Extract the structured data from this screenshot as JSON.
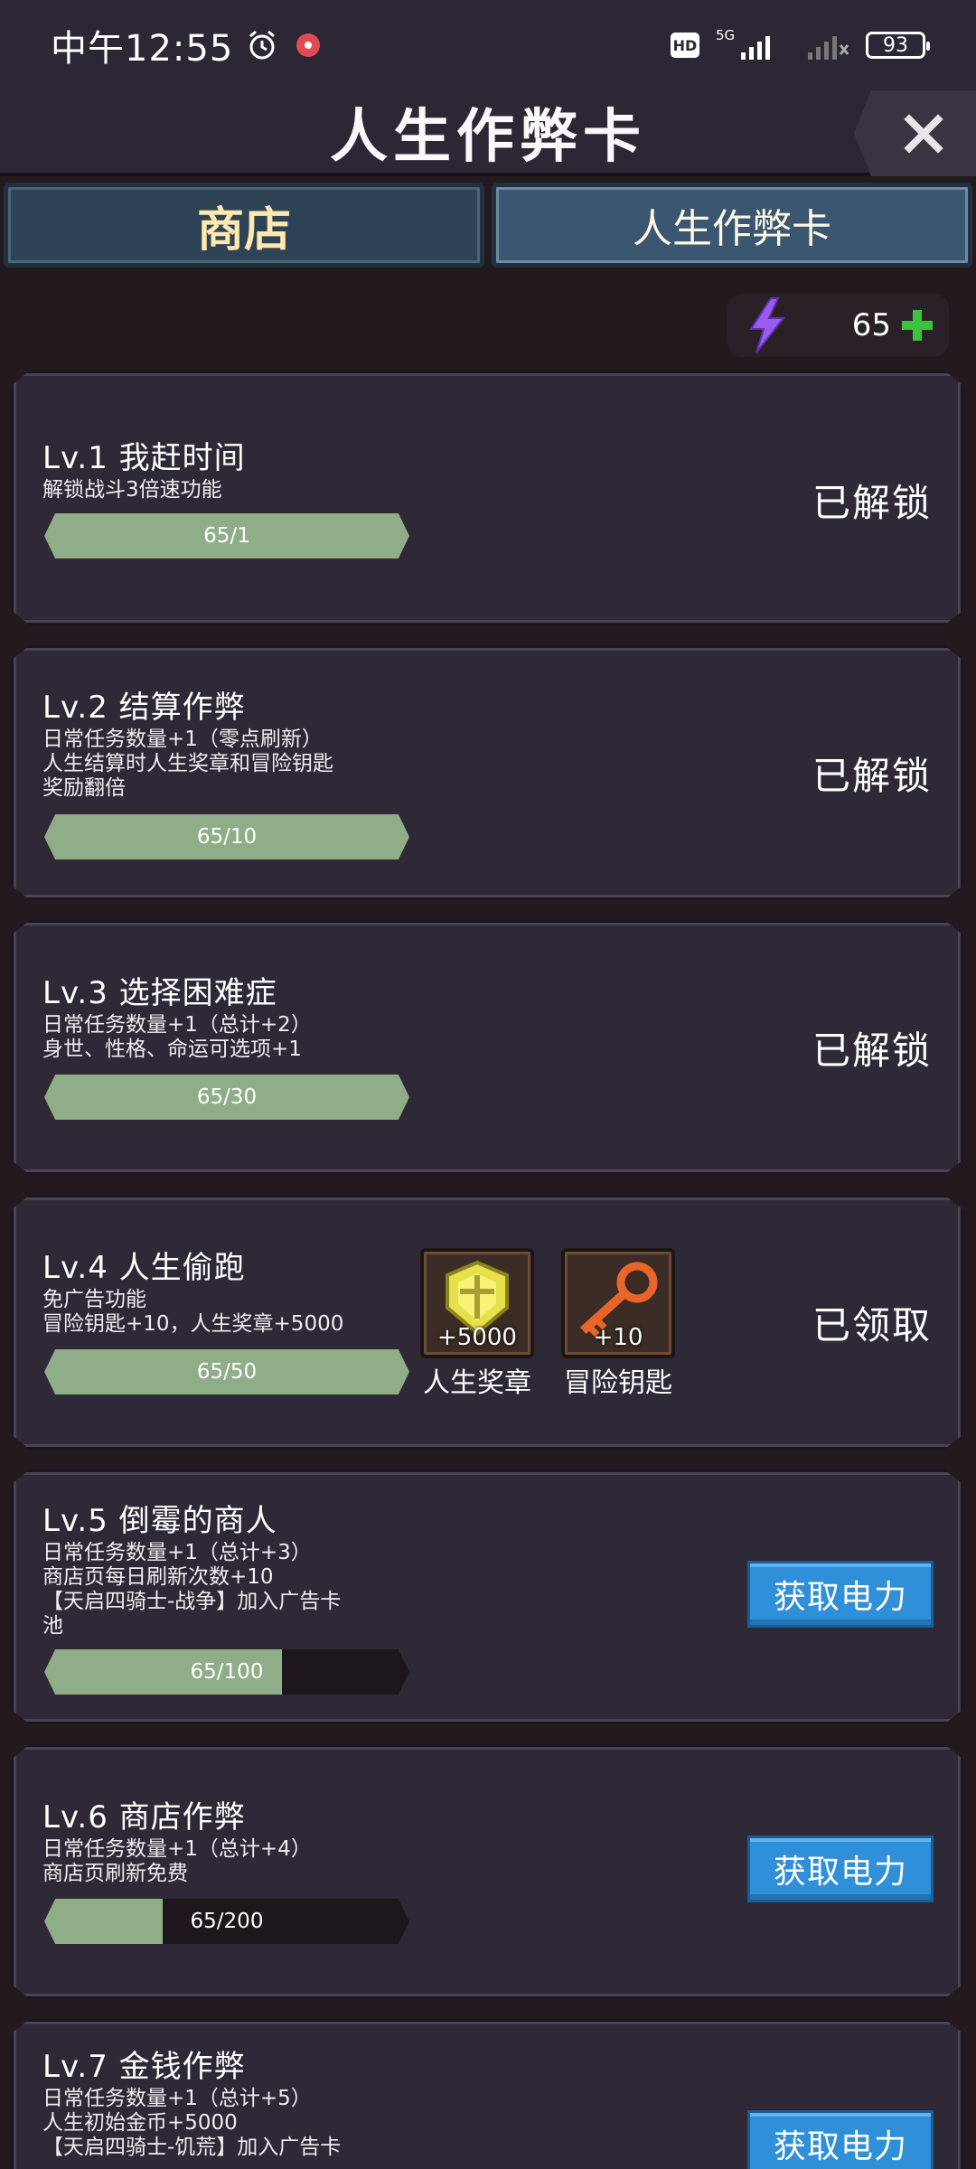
{
  "status_bar": {
    "time": "中午12:55",
    "hd": "HD",
    "network": "5G",
    "battery": "93",
    "icons": [
      "alarm-icon",
      "recording-icon",
      "signal-icon",
      "wifi-icon",
      "battery-icon"
    ]
  },
  "header": {
    "title": "人生作弊卡",
    "close_icon": "close-icon"
  },
  "tabs": [
    {
      "label": "商店",
      "active": false
    },
    {
      "label": "人生作弊卡",
      "active": true
    }
  ],
  "energy": {
    "count": "65",
    "icon": "lightning-icon",
    "plus_icon": "plus-icon"
  },
  "cards": [
    {
      "title": "Lv.1 我赶时间",
      "desc": [
        "解锁战斗3倍速功能"
      ],
      "progress_text": "65/1",
      "progress": 1.0,
      "status": "已解锁"
    },
    {
      "title": "Lv.2 结算作弊",
      "desc": [
        "日常任务数量+1（零点刷新）",
        "人生结算时人生奖章和冒险钥匙",
        "奖励翻倍"
      ],
      "progress_text": "65/10",
      "progress": 1.0,
      "status": "已解锁"
    },
    {
      "title": "Lv.3 选择困难症",
      "desc": [
        "日常任务数量+1（总计+2）",
        "身世、性格、命运可选项+1"
      ],
      "progress_text": "65/30",
      "progress": 1.0,
      "status": "已解锁"
    },
    {
      "title": "Lv.4 人生偷跑",
      "desc": [
        "免广告功能",
        "冒险钥匙+10，人生奖章+5000"
      ],
      "progress_text": "65/50",
      "progress": 1.0,
      "status": "已领取",
      "rewards": [
        {
          "label": "人生奖章",
          "qty": "+5000",
          "icon": "medal-icon"
        },
        {
          "label": "冒险钥匙",
          "qty": "+10",
          "icon": "key-icon"
        }
      ]
    },
    {
      "title": "Lv.5 倒霉的商人",
      "desc": [
        "日常任务数量+1（总计+3）",
        "商店页每日刷新次数+10",
        "【天启四骑士-战争】加入广告卡",
        "池"
      ],
      "progress_text": "65/100",
      "progress": 0.65,
      "button": "获取电力"
    },
    {
      "title": "Lv.6 商店作弊",
      "desc": [
        "日常任务数量+1（总计+4）",
        "商店页刷新免费"
      ],
      "progress_text": "65/200",
      "progress": 0.325,
      "button": "获取电力"
    },
    {
      "title": "Lv.7 金钱作弊",
      "desc": [
        "日常任务数量+1（总计+5）",
        "人生初始金币+5000",
        "【天启四骑士-饥荒】加入广告卡"
      ],
      "button": "获取电力"
    }
  ],
  "colors": {
    "background": "#231a1f",
    "card": "#2f2837",
    "progress_fill": "#8fad87",
    "button": "#2f8fd8",
    "energy_icon": "#9a5cf0",
    "plus": "#3dc23d"
  }
}
